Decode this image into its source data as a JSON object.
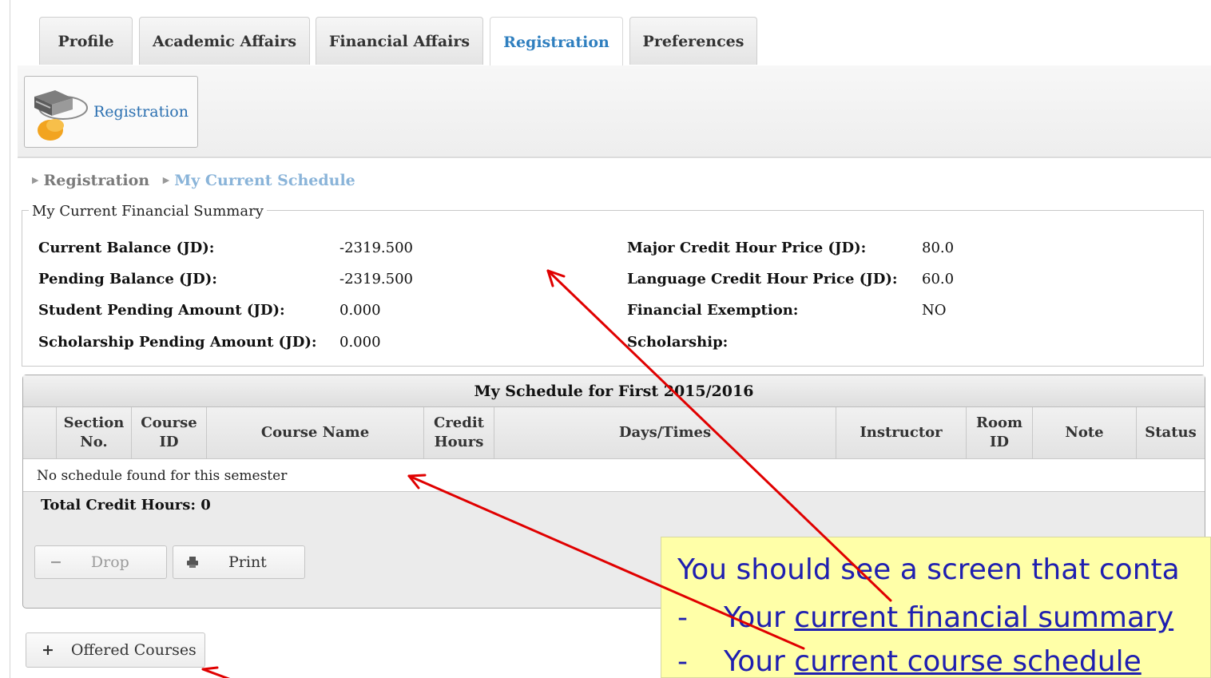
{
  "tabs": [
    {
      "label": "Profile"
    },
    {
      "label": "Academic Affairs"
    },
    {
      "label": "Financial Affairs"
    },
    {
      "label": "Registration"
    },
    {
      "label": "Preferences"
    }
  ],
  "active_tab": "Registration",
  "toolbar": {
    "registration_label": "Registration"
  },
  "breadcrumb": {
    "item1": "Registration",
    "item2": "My Current Schedule"
  },
  "financial_summary": {
    "legend": "My Current Financial Summary",
    "left": [
      {
        "label": "Current Balance (JD):",
        "value": "-2319.500"
      },
      {
        "label": "Pending Balance (JD):",
        "value": "-2319.500"
      },
      {
        "label": "Student Pending Amount (JD):",
        "value": "0.000"
      },
      {
        "label": "Scholarship Pending Amount (JD):",
        "value": "0.000"
      }
    ],
    "right": [
      {
        "label": "Major Credit Hour Price (JD):",
        "value": "80.0"
      },
      {
        "label": "Language Credit Hour Price (JD):",
        "value": "60.0"
      },
      {
        "label": "Financial Exemption:",
        "value": "NO"
      },
      {
        "label": "Scholarship:",
        "value": ""
      }
    ]
  },
  "schedule": {
    "title": "My Schedule for First 2015/2016",
    "columns": {
      "section_no": "Section No.",
      "course_id": "Course ID",
      "course_name": "Course Name",
      "credit_hours": "Credit Hours",
      "days_times": "Days/Times",
      "instructor": "Instructor",
      "room_id": "Room ID",
      "note": "Note",
      "status": "Status"
    },
    "empty_message": "No schedule found for this semester",
    "total_credit_hours": "Total Credit Hours: 0",
    "drop_label": "Drop",
    "print_label": "Print"
  },
  "offered_courses_label": "Offered Courses",
  "callout": {
    "line1": "You should see a screen that conta",
    "bullet1_prefix": "Your ",
    "bullet1_link": "current financial summary",
    "bullet2_prefix": "Your ",
    "bullet2_link": "current course schedule",
    "dash": "-"
  },
  "colors": {
    "active_tab": "#2f7fbf",
    "breadcrumb_current": "#8ab4d9",
    "callout_bg": "#ffffa8",
    "callout_text": "#1f1fb0",
    "arrow": "#e00000"
  }
}
